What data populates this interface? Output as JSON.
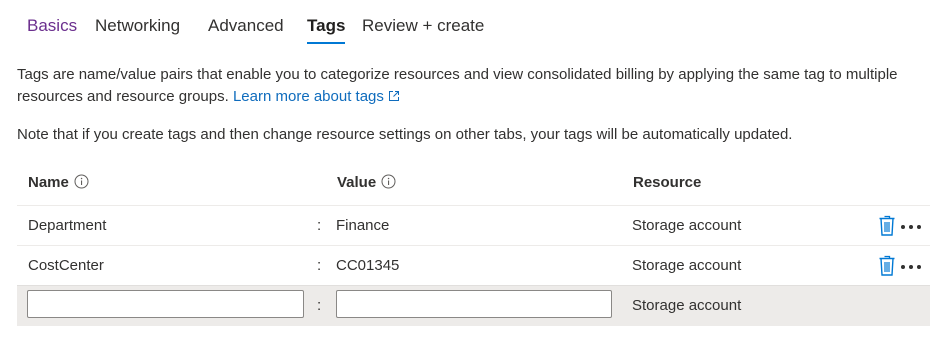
{
  "tabs": [
    {
      "label": "Basics",
      "state": "visited"
    },
    {
      "label": "Networking",
      "state": "normal"
    },
    {
      "label": "Advanced",
      "state": "normal"
    },
    {
      "label": "Tags",
      "state": "active"
    },
    {
      "label": "Review + create",
      "state": "normal"
    }
  ],
  "description": {
    "text": "Tags are name/value pairs that enable you to categorize resources and view consolidated billing by applying the same tag to multiple resources and resource groups.",
    "link_label": "Learn more about tags",
    "link_icon": "external-link-icon"
  },
  "note": "Note that if you create tags and then change resource settings on other tabs, your tags will be automatically updated.",
  "table": {
    "headers": {
      "name": "Name",
      "value": "Value",
      "resource": "Resource"
    },
    "header_icon": "info-icon",
    "separator": ":",
    "rows": [
      {
        "name": "Department",
        "value": "Finance",
        "resource": "Storage account"
      },
      {
        "name": "CostCenter",
        "value": "CC01345",
        "resource": "Storage account"
      }
    ],
    "new_row": {
      "name_value": "",
      "value_value": "",
      "resource": "Storage account"
    },
    "row_actions": [
      "trash-icon",
      "more-icon"
    ]
  },
  "colors": {
    "accent": "#0078d4",
    "link": "#0f6cbd",
    "visited": "#6b2f8e",
    "new_row_bg": "#edebe9"
  }
}
